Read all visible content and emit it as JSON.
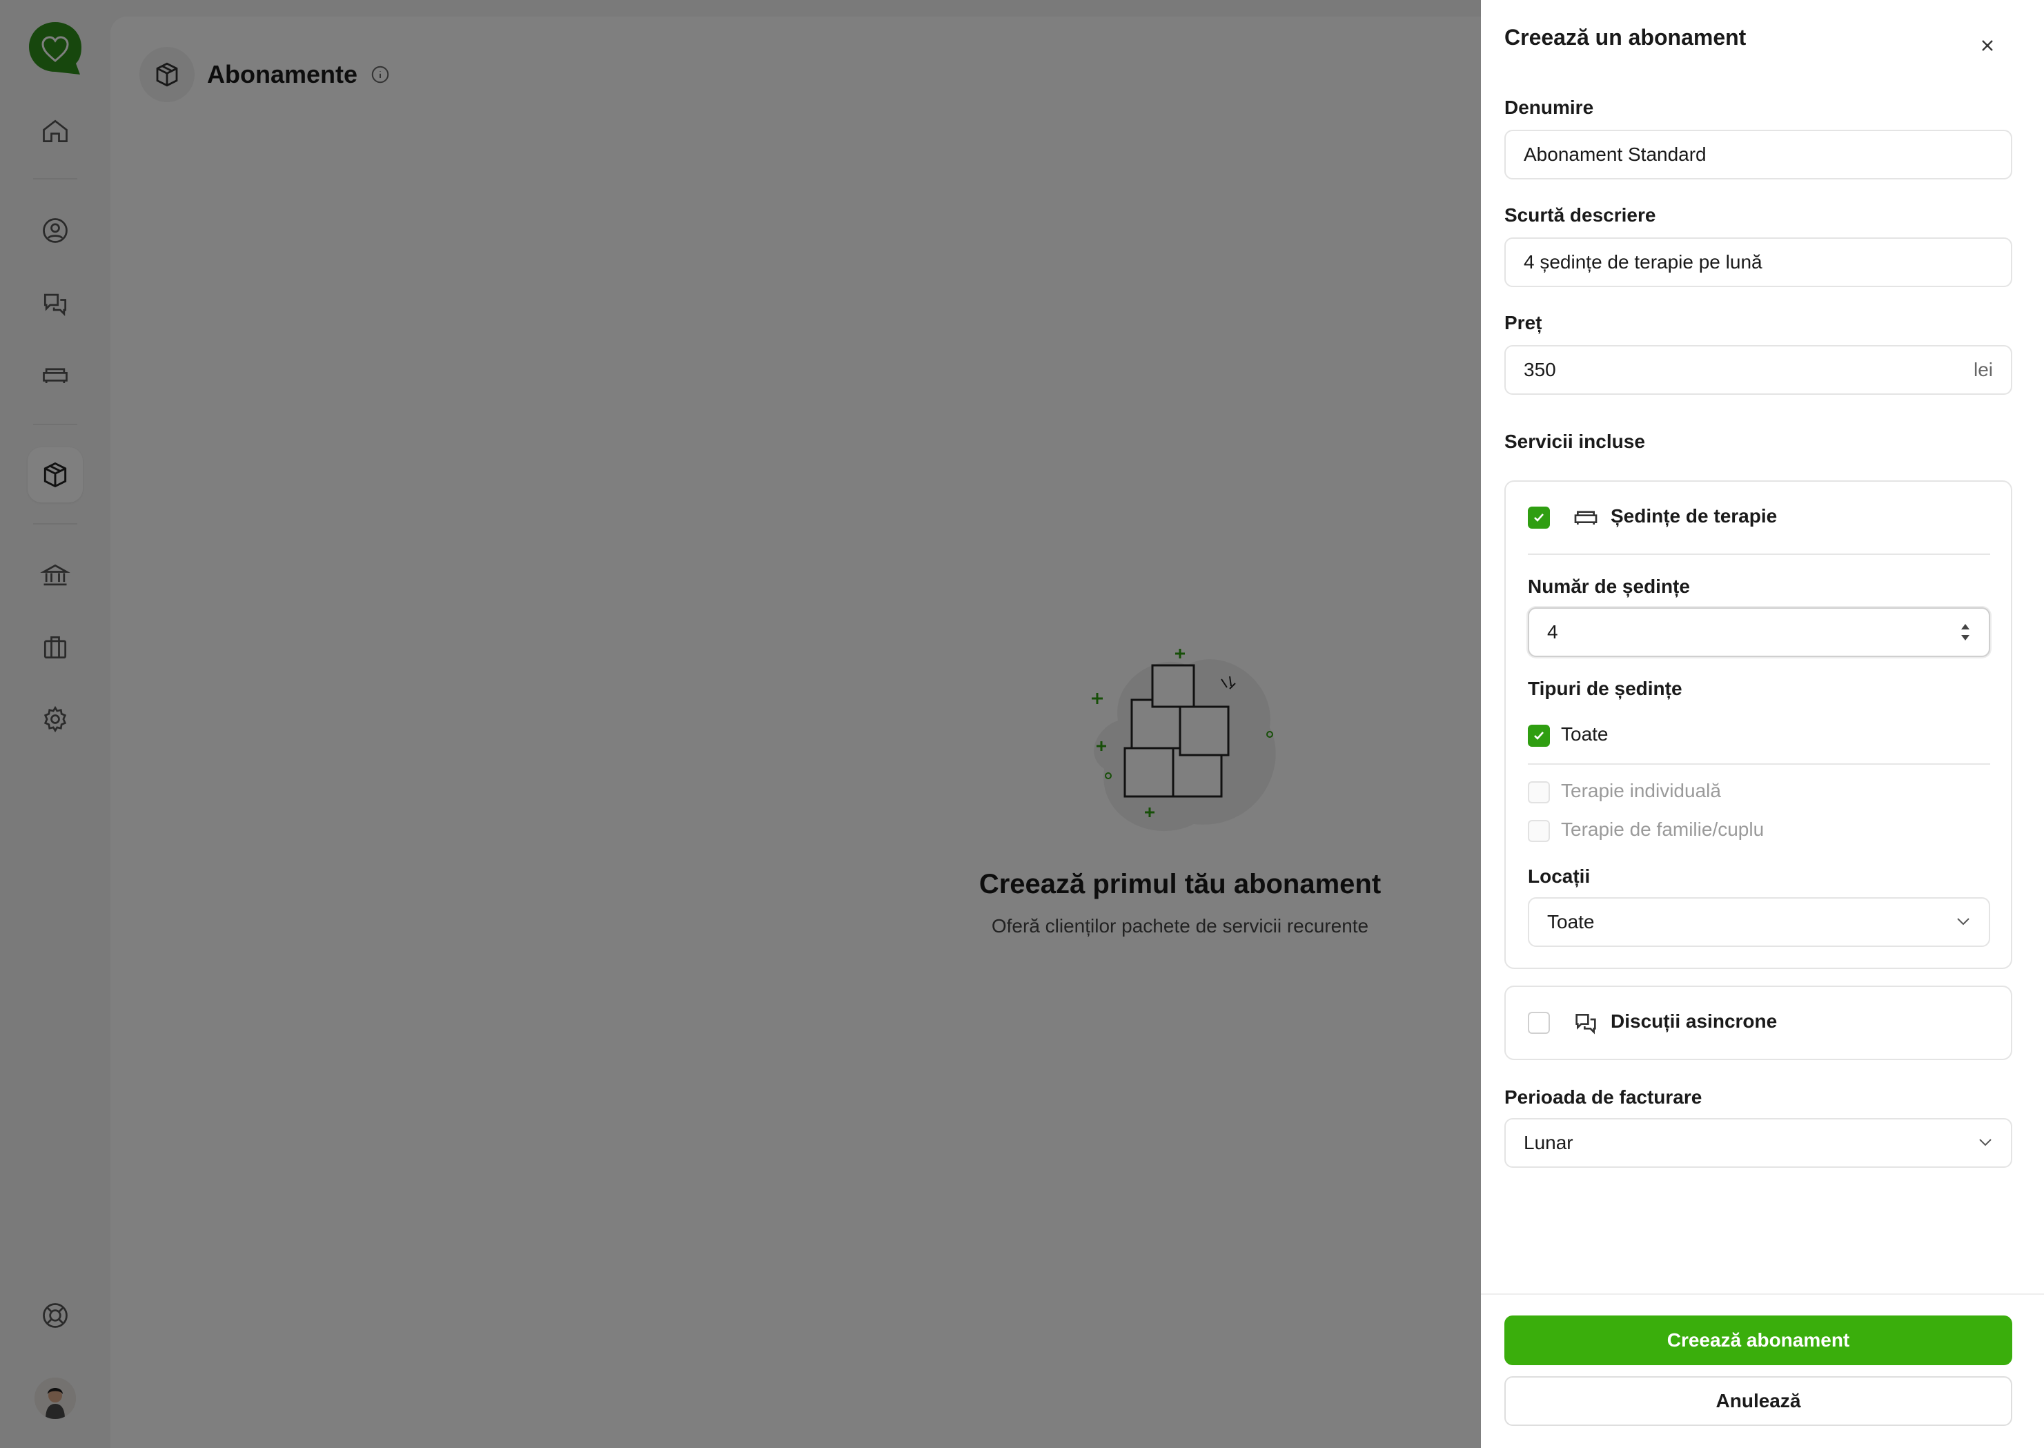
{
  "page": {
    "title": "Abonamente"
  },
  "empty_state": {
    "title": "Creează primul tău abonament",
    "subtitle": "Oferă clienților pachete de servicii recurente"
  },
  "sidebar": {
    "items": [
      {
        "name": "home",
        "icon": "home-icon"
      },
      {
        "name": "clients",
        "icon": "user-circle-icon"
      },
      {
        "name": "messages",
        "icon": "chat-bubbles-icon"
      },
      {
        "name": "sessions",
        "icon": "sofa-icon"
      },
      {
        "name": "subscriptions",
        "icon": "package-icon",
        "active": true
      },
      {
        "name": "finance",
        "icon": "bank-icon"
      },
      {
        "name": "business",
        "icon": "briefcase-icon"
      },
      {
        "name": "settings",
        "icon": "gear-icon"
      },
      {
        "name": "support",
        "icon": "lifebuoy-icon"
      }
    ]
  },
  "drawer": {
    "title": "Creează un abonament",
    "name_label": "Denumire",
    "name_value": "Abonament Standard",
    "description_label": "Scurtă descriere",
    "description_value": "4 ședințe de terapie pe lună",
    "price_label": "Preț",
    "price_value": "350",
    "price_suffix": "lei",
    "services_label": "Servicii incluse",
    "therapy": {
      "label": "Ședințe de terapie",
      "checked": true,
      "count_label": "Număr de ședințe",
      "count_value": "4",
      "types_label": "Tipuri de ședințe",
      "types_all": "Toate",
      "types": [
        "Terapie individuală",
        "Terapie de familie/cuplu"
      ],
      "locations_label": "Locații",
      "locations_value": "Toate"
    },
    "async": {
      "label": "Discuții asincrone",
      "checked": false
    },
    "billing_label": "Perioada de facturare",
    "billing_value": "Lunar",
    "create_button": "Creează abonament",
    "cancel_button": "Anulează"
  },
  "colors": {
    "accent": "#3aae0c",
    "checkbox": "#2f9e11"
  }
}
